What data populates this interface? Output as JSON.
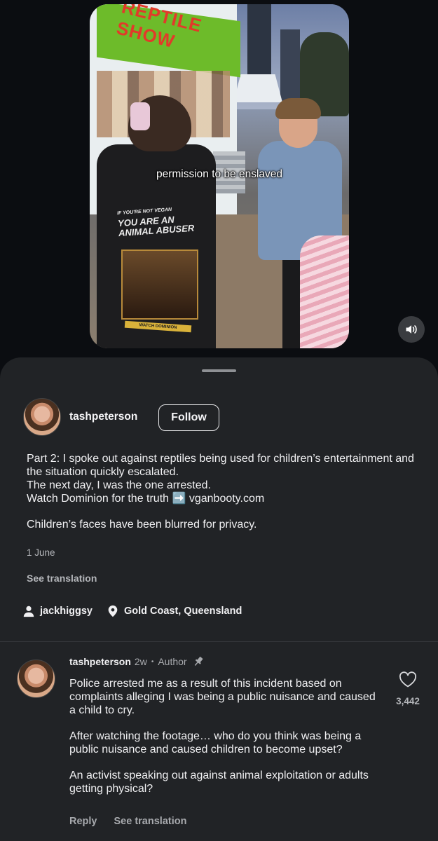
{
  "video": {
    "overlay_caption": "permission to be enslaved",
    "stall_sign_text": "REPTILE SHOW",
    "shirt_text_small": "IF YOU'RE NOT VEGAN",
    "shirt_text_large": "YOU ARE AN ANIMAL ABUSER",
    "shirt_band_text": "WATCH DOMINION",
    "mute_icon": "volume-on-icon"
  },
  "post": {
    "username": "tashpeterson",
    "follow_label": "Follow",
    "caption_lines": [
      "Part 2: I spoke out against reptiles being used for children’s entertainment and the situation quickly escalated.\nThe next day, I was the one arrested.\nWatch Dominion for the truth ➡️ vganbooty.com",
      "Children’s faces have been blurred for privacy."
    ],
    "date": "1 June",
    "see_translation": "See translation",
    "tagged_user": "jackhiggsy",
    "location": "Gold Coast, Queensland"
  },
  "comment": {
    "username": "tashpeterson",
    "time": "2w",
    "separator": "•",
    "role": "Author",
    "paragraphs": [
      "Police arrested me as a result of this incident based on complaints alleging I was being a public nuisance and caused a child to cry.",
      "After watching the footage… who do you think was being a public nuisance and caused children to become upset?",
      "An activist speaking out against animal exploitation or adults getting physical?"
    ],
    "reply_label": "Reply",
    "see_translation": "See translation",
    "like_count": "3,442"
  },
  "colors": {
    "background": "#0b0d11",
    "sheet": "#212326",
    "text": "#f0f0f2",
    "muted": "#a8aaae"
  }
}
